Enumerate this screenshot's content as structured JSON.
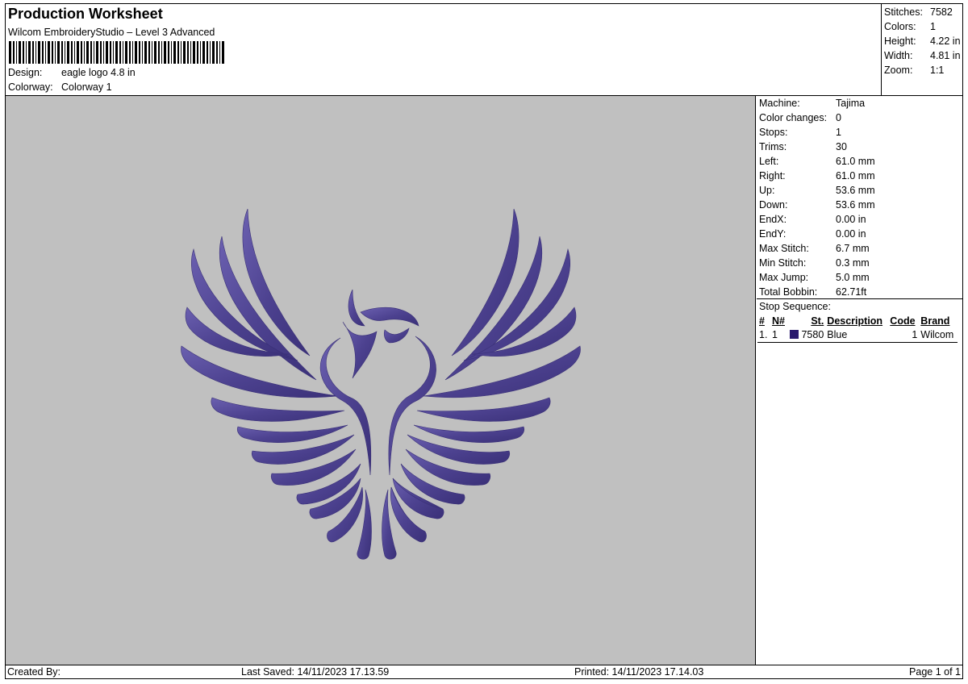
{
  "header": {
    "title": "Production Worksheet",
    "subtitle": "Wilcom EmbroideryStudio – Level 3 Advanced",
    "design_label": "Design:",
    "design_value": "eagle logo 4.8 in",
    "colorway_label": "Colorway:",
    "colorway_value": "Colorway 1"
  },
  "summary": [
    {
      "label": "Stitches:",
      "value": "7582"
    },
    {
      "label": "Colors:",
      "value": "1"
    },
    {
      "label": "Height:",
      "value": "4.22 in"
    },
    {
      "label": "Width:",
      "value": "4.81 in"
    },
    {
      "label": "Zoom:",
      "value": "1:1"
    }
  ],
  "stats": [
    {
      "label": "Machine:",
      "value": "Tajima"
    },
    {
      "label": "Color changes:",
      "value": "0"
    },
    {
      "label": "Stops:",
      "value": "1"
    },
    {
      "label": "Trims:",
      "value": "30"
    },
    {
      "label": "Left:",
      "value": "61.0 mm"
    },
    {
      "label": "Right:",
      "value": "61.0 mm"
    },
    {
      "label": "Up:",
      "value": "53.6 mm"
    },
    {
      "label": "Down:",
      "value": "53.6 mm"
    },
    {
      "label": "EndX:",
      "value": "0.00 in"
    },
    {
      "label": "EndY:",
      "value": "0.00 in"
    },
    {
      "label": "Max Stitch:",
      "value": "6.7 mm"
    },
    {
      "label": "Min Stitch:",
      "value": "0.3 mm"
    },
    {
      "label": "Max Jump:",
      "value": "5.0 mm"
    },
    {
      "label": "Total Bobbin:",
      "value": "62.71ft"
    }
  ],
  "stop_sequence": {
    "label": "Stop Sequence:",
    "columns": [
      "#",
      "N#",
      "St.",
      "Description",
      "Code",
      "Brand"
    ],
    "rows": [
      {
        "num": "1.",
        "n": "1",
        "swatch_color": "#2a1a6e",
        "stitches": "7580",
        "description": "Blue",
        "code": "1",
        "brand": "Wilcom"
      }
    ]
  },
  "design": {
    "thread_color": "#4d4290",
    "thread_highlight": "#6b60b0",
    "background_color": "#c0c0c0",
    "icon": "eagle-embroidery-icon"
  },
  "footer": {
    "created_by": "Created By:",
    "last_saved": "Last Saved: 14/11/2023 17.13.59",
    "printed": "Printed: 14/11/2023 17.14.03",
    "page": "Page 1 of 1"
  }
}
